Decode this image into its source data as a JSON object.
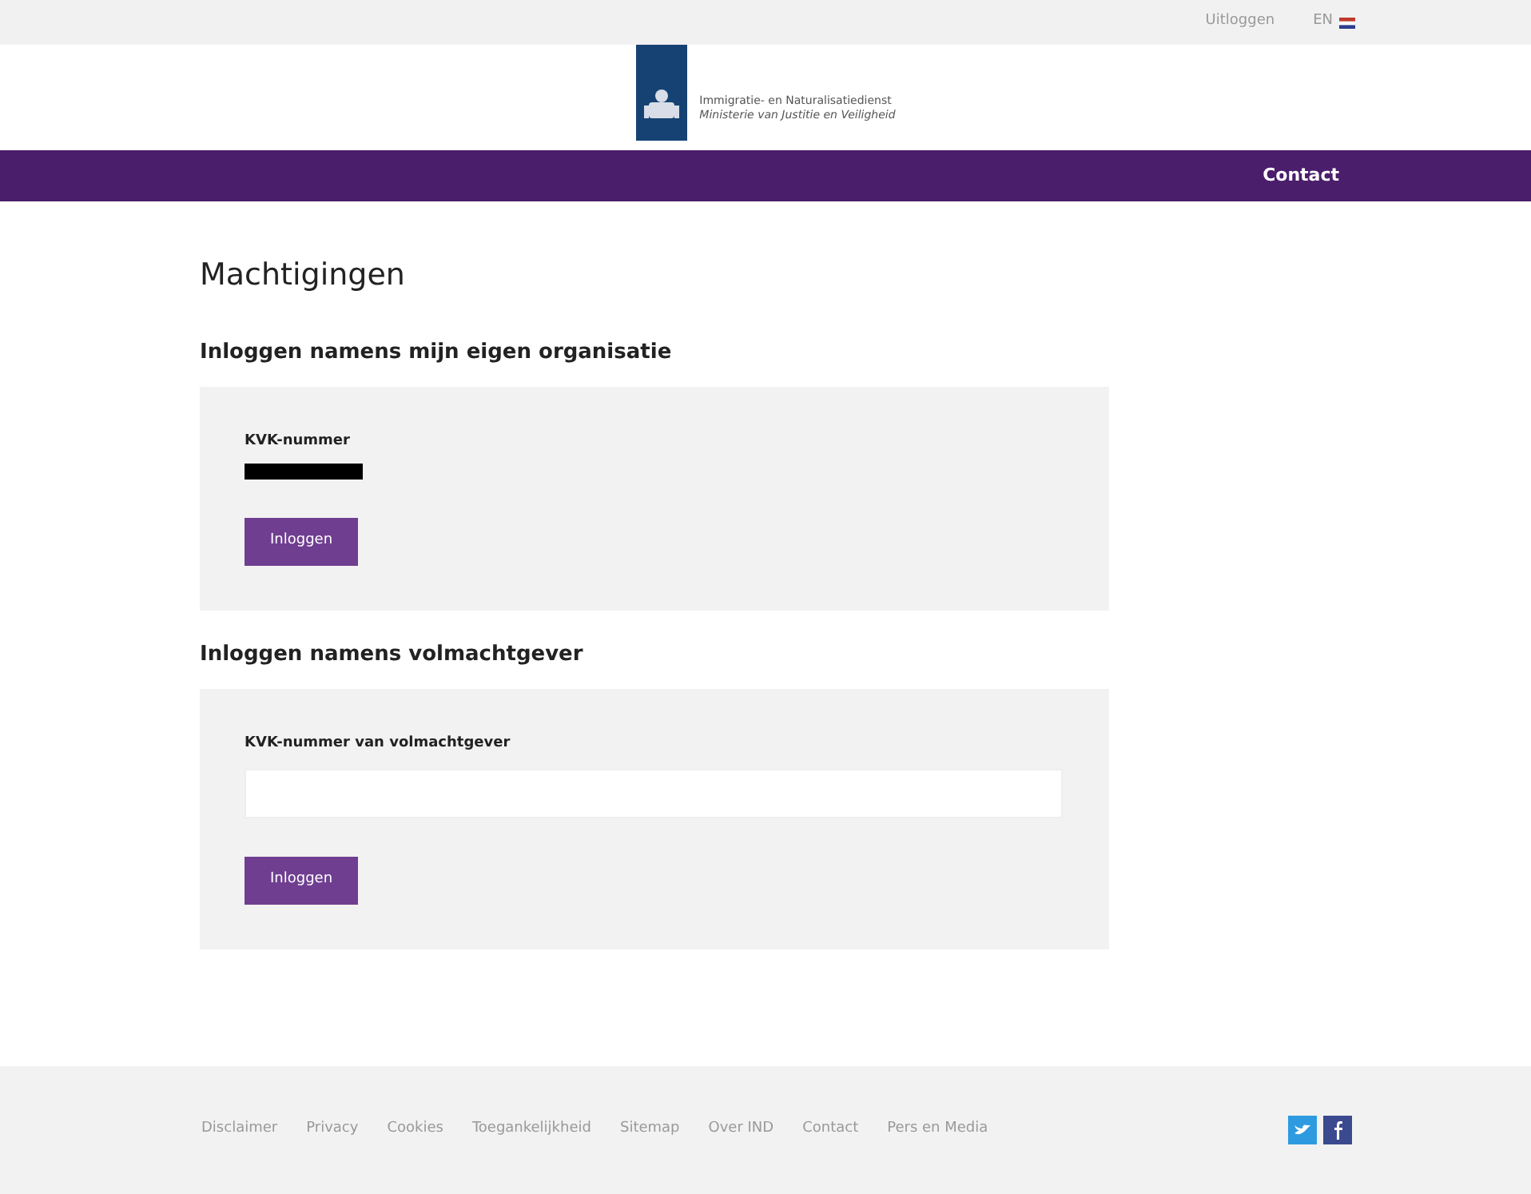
{
  "top_bar": {
    "logout_link": "Uitloggen",
    "language_link": "EN"
  },
  "logo": {
    "line_1": "Immigratie- en Naturalisatiedienst",
    "line_2": "Ministerie van Justitie en Veiligheid"
  },
  "nav": {
    "items": [
      "Contact"
    ]
  },
  "page_title": "Machtigingen",
  "sections": [
    {
      "heading": "Inloggen namens mijn eigen organisatie",
      "field_label": "KVK-nummer",
      "kind": "redacted",
      "button": "Inloggen"
    },
    {
      "heading": "Inloggen namens volmachtgever",
      "field_label": "KVK-nummer van volmachtgever",
      "kind": "input",
      "button": "Inloggen"
    }
  ],
  "footer": {
    "links": [
      "Disclaimer",
      "Privacy",
      "Cookies",
      "Toegankelijkheid",
      "Sitemap",
      "Over IND",
      "Contact",
      "Pers en Media"
    ]
  }
}
